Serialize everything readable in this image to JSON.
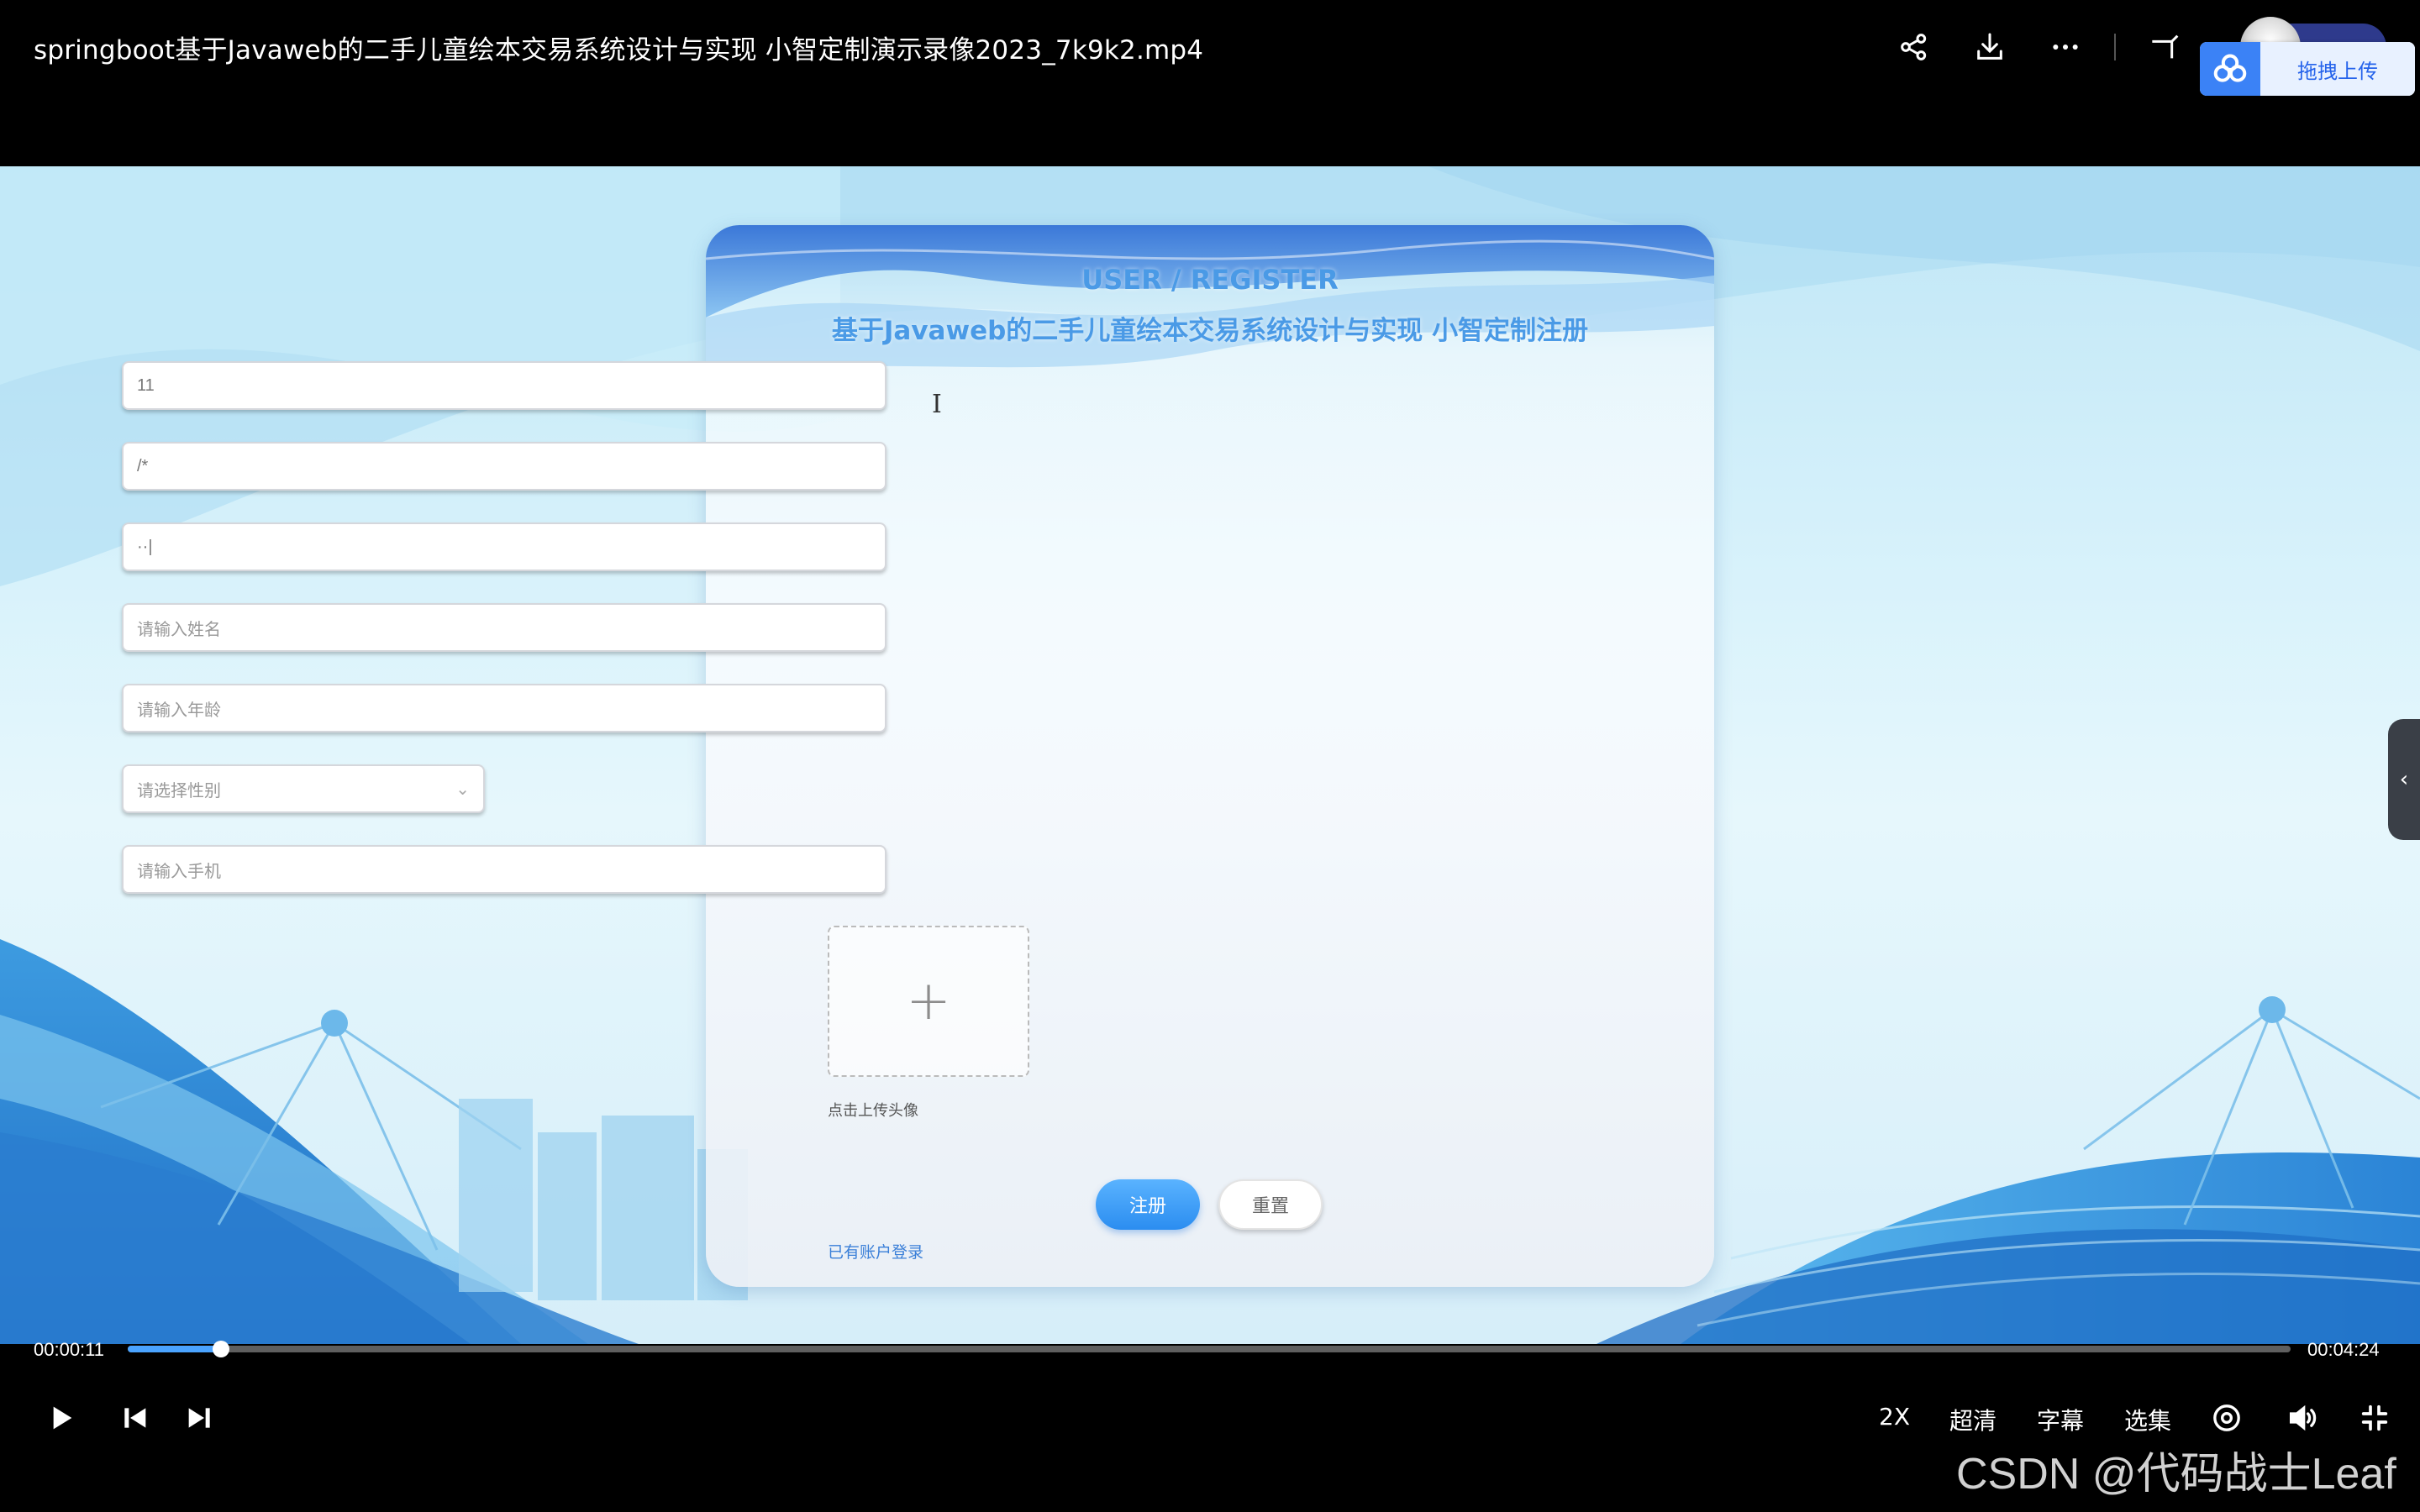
{
  "player": {
    "title": "springboot基于Javaweb的二手儿童绘本交易系统设计与实现 小智定制演示录像2023_7k9k2.mp4",
    "upload_widget_label": "拖拽上传",
    "current_time": "00:00:11",
    "total_time": "00:04:24",
    "progress": 0.043,
    "speed_label": "2X",
    "quality_label": "超清",
    "subtitle_label": "字幕",
    "episodes_label": "选集",
    "icons": [
      "share-icon",
      "download-icon",
      "more-icon",
      "pip-icon",
      "play-icon",
      "previous-icon",
      "next-icon",
      "settings-icon",
      "volume-icon",
      "exit-fullscreen-icon"
    ],
    "accent_color": "#4aa3ff"
  },
  "register": {
    "heading_en": "USER / REGISTER",
    "heading_cn": "基于Javaweb的二手儿童绘本交易系统设计与实现 小智定制注册",
    "account_value": "11",
    "password_value": "/*",
    "confirm_value": "··|",
    "name_placeholder": "请输入姓名",
    "age_placeholder": "请输入年龄",
    "gender_placeholder": "请选择性别",
    "phone_placeholder": "请输入手机",
    "upload_hint": "点击上传头像",
    "register_button": "注册",
    "reset_button": "重置",
    "login_link": "已有账户登录",
    "accent_color": "#2b8df0"
  },
  "watermark": "CSDN @代码战士Leaf"
}
